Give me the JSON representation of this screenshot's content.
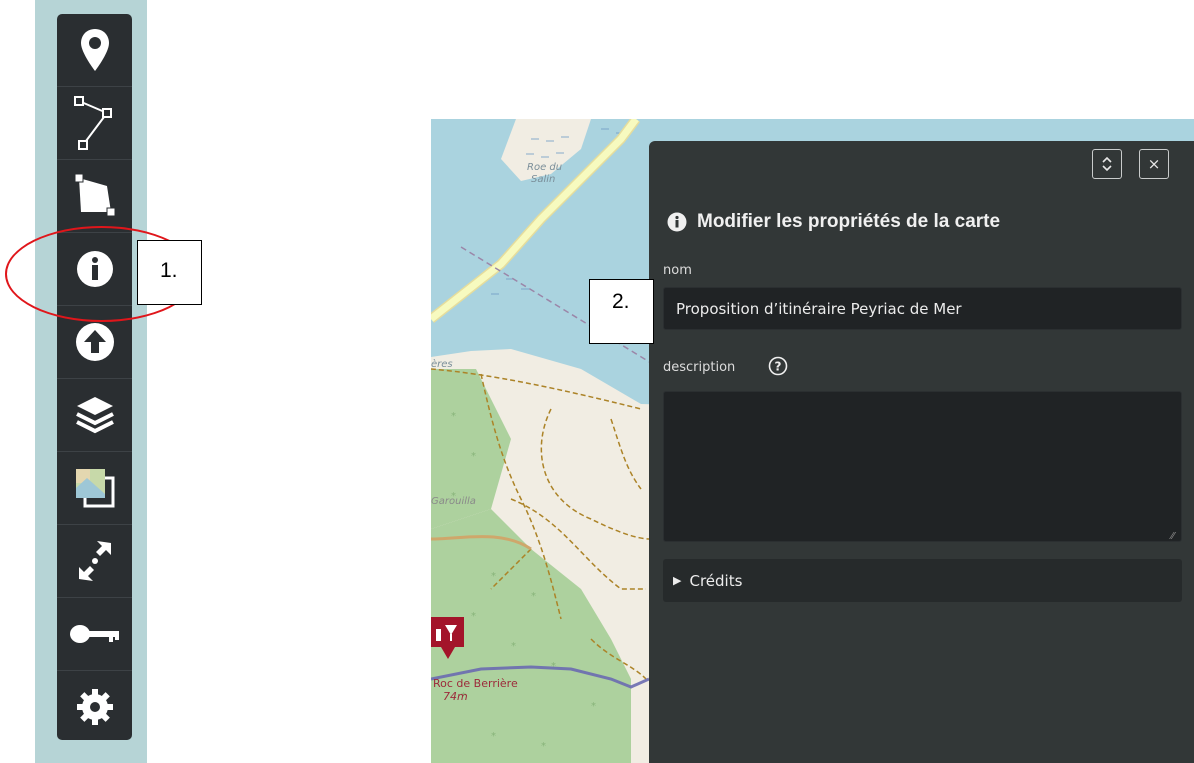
{
  "annotations": {
    "marker_1": "1.",
    "marker_2": "2."
  },
  "toolbar": {
    "items": [
      {
        "name": "draw-marker",
        "icon": "map-pin-icon"
      },
      {
        "name": "draw-polyline",
        "icon": "polyline-icon"
      },
      {
        "name": "draw-polygon",
        "icon": "polygon-icon"
      },
      {
        "name": "edit-map-properties",
        "icon": "info-circle-icon"
      },
      {
        "name": "import-data",
        "icon": "upload-icon"
      },
      {
        "name": "manage-layers",
        "icon": "layers-icon"
      },
      {
        "name": "change-tilelayer",
        "icon": "tilelayer-icon"
      },
      {
        "name": "center-map",
        "icon": "center-arrows-icon"
      },
      {
        "name": "permissions",
        "icon": "key-icon"
      },
      {
        "name": "settings",
        "icon": "gear-icon"
      }
    ]
  },
  "map": {
    "labels": {
      "roe_du_salin": [
        "Roe du",
        "Salin"
      ],
      "berrieres_partial": "ères",
      "garouilla": "Garouilla",
      "berriere": "Roc de Berrière",
      "elevation": "74m"
    },
    "colors": {
      "water": "#aad3df",
      "land": "#f1ede3",
      "forest": "#add19e",
      "road": "#f7fabf",
      "track": "#ac8327",
      "route": "#6a6ab0",
      "poi": "#a3142a"
    }
  },
  "panel": {
    "title": "Modifier les propriétés de la carte",
    "name_label": "nom",
    "name_value": "Proposition d’itinéraire Peyriac de Mer",
    "description_label": "description",
    "description_value": "",
    "credits_label": "Crédits",
    "buttons": {
      "toggle_icon": "expand-collapse-icon",
      "close": "×"
    }
  }
}
